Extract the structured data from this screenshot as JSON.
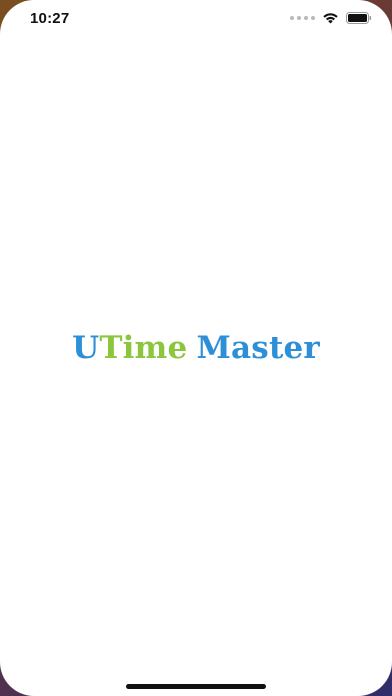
{
  "status_bar": {
    "time": "10:27",
    "icons": [
      "cellular-signal-icon",
      "wifi-icon",
      "battery-icon"
    ]
  },
  "splash": {
    "title_part_u": "U",
    "title_part_time": "Time",
    "title_part_master": "Master"
  },
  "colors": {
    "brand_blue": "#2f8fd6",
    "brand_green": "#8cc63f",
    "background": "#ffffff"
  }
}
